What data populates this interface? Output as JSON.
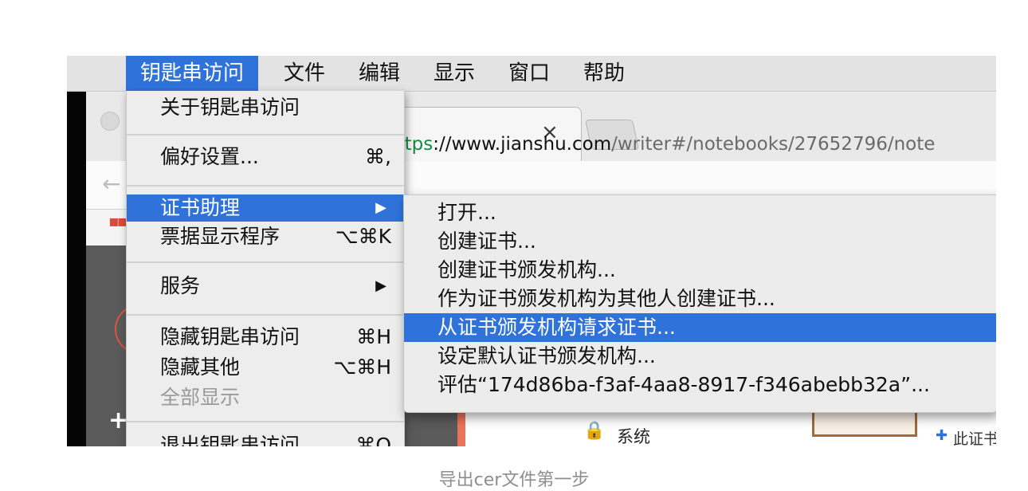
{
  "menubar": {
    "apple_icon": "apple-logo",
    "items": [
      "钥匙串访问",
      "文件",
      "编辑",
      "显示",
      "窗口",
      "帮助"
    ]
  },
  "browser": {
    "tab_close": "×",
    "url_scheme": "https",
    "url_domain": "://www.jianshu.com",
    "url_path": "/writer#/notebooks/27652796/note"
  },
  "keychain_menu": {
    "about": "关于钥匙串访问",
    "preferences": "偏好设置...",
    "preferences_shortcut": "⌘,",
    "cert_assistant": "证书助理",
    "ticket_viewer": "票据显示程序",
    "ticket_viewer_shortcut": "⌥⌘K",
    "services": "服务",
    "hide": "隐藏钥匙串访问",
    "hide_shortcut": "⌘H",
    "hide_others": "隐藏其他",
    "hide_others_shortcut": "⌥⌘H",
    "show_all": "全部显示",
    "quit": "退出钥匙串访问",
    "quit_shortcut": "⌘Q",
    "submenu_arrow": "▶"
  },
  "cert_submenu": {
    "items": [
      "打开...",
      "创建证书...",
      "创建证书颁发机构...",
      "作为证书颁发机构为其他人创建证书...",
      "从证书颁发机构请求证书...",
      "设定默认证书颁发机构...",
      "评估“174d86ba-f3af-4aa8-8917-f346abebb32a”..."
    ],
    "highlighted_index": 4
  },
  "keychain_window": {
    "system_label": "系统",
    "cert_note": "此证书"
  },
  "caption": "导出cer文件第一步",
  "colors": {
    "highlight": "#2f73da",
    "menu_bg": "#ededed"
  }
}
